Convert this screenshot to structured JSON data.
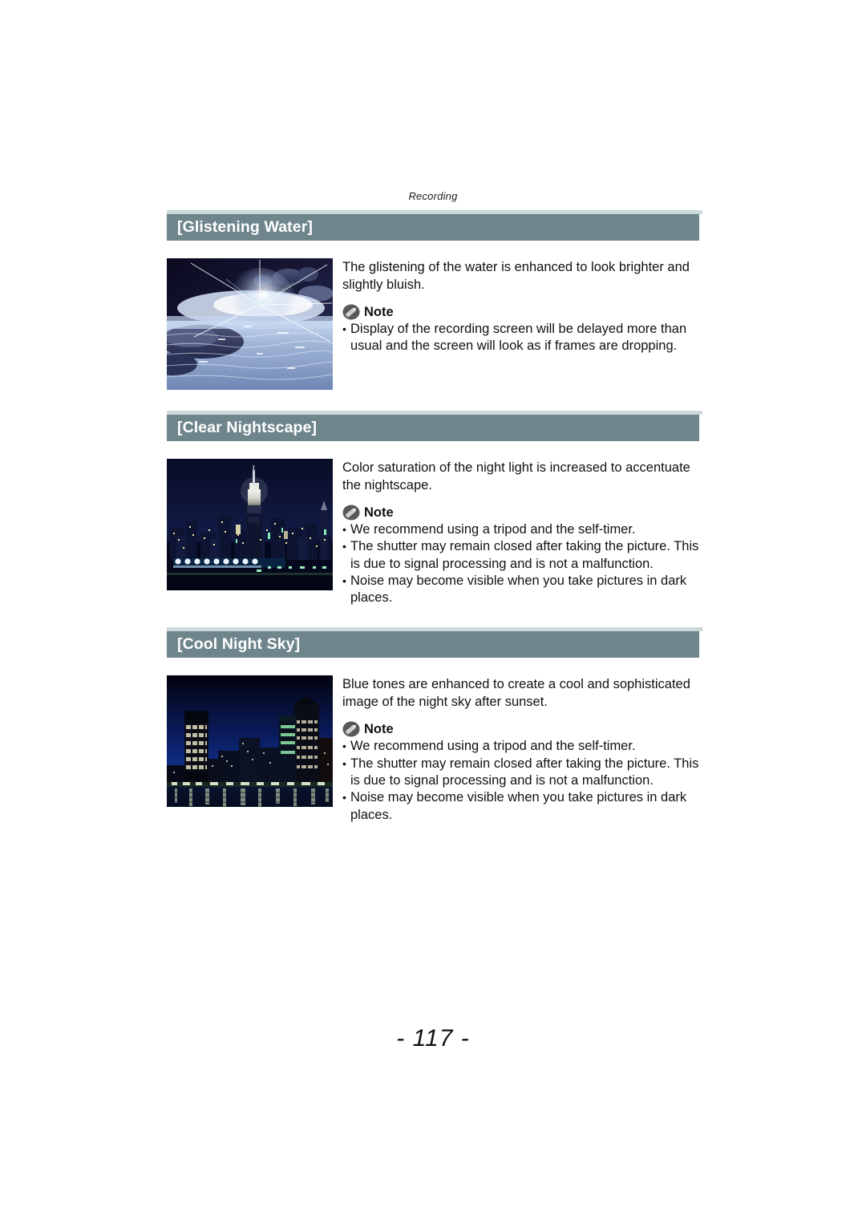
{
  "running_head": "Recording",
  "page_number": "- 117 -",
  "theme": {
    "header_bar_color": "#6e858c",
    "header_cap_color": "#ccd9d9",
    "header_text_color": "#ffffff",
    "body_text_color": "#111111"
  },
  "sections": [
    {
      "id": "glistening-water",
      "title": "[Glistening Water]",
      "image_alt": "glistening-water-photo",
      "description": "The glistening of the water is enhanced to look brighter and slightly bluish.",
      "note_label": "Note",
      "note_icon": "pencil-note-icon",
      "notes": [
        "Display of the recording screen will be delayed more than usual and the screen will look as if frames are dropping."
      ]
    },
    {
      "id": "clear-nightscape",
      "title": "[Clear Nightscape]",
      "image_alt": "clear-nightscape-photo",
      "description": "Color saturation of the night light is increased to accentuate the nightscape.",
      "note_label": "Note",
      "note_icon": "pencil-note-icon",
      "notes": [
        "We recommend using a tripod and the self-timer.",
        "The shutter may remain closed after taking the picture. This is due to signal processing and is not a malfunction.",
        "Noise may become visible when you take pictures in dark places."
      ]
    },
    {
      "id": "cool-night-sky",
      "title": "[Cool Night Sky]",
      "image_alt": "cool-night-sky-photo",
      "description": "Blue tones are enhanced to create a cool and sophisticated image of the night sky after sunset.",
      "note_label": "Note",
      "note_icon": "pencil-note-icon",
      "notes": [
        "We recommend using a tripod and the self-timer.",
        "The shutter may remain closed after taking the picture. This is due to signal processing and is not a malfunction.",
        "Noise may become visible when you take pictures in dark places."
      ]
    }
  ]
}
